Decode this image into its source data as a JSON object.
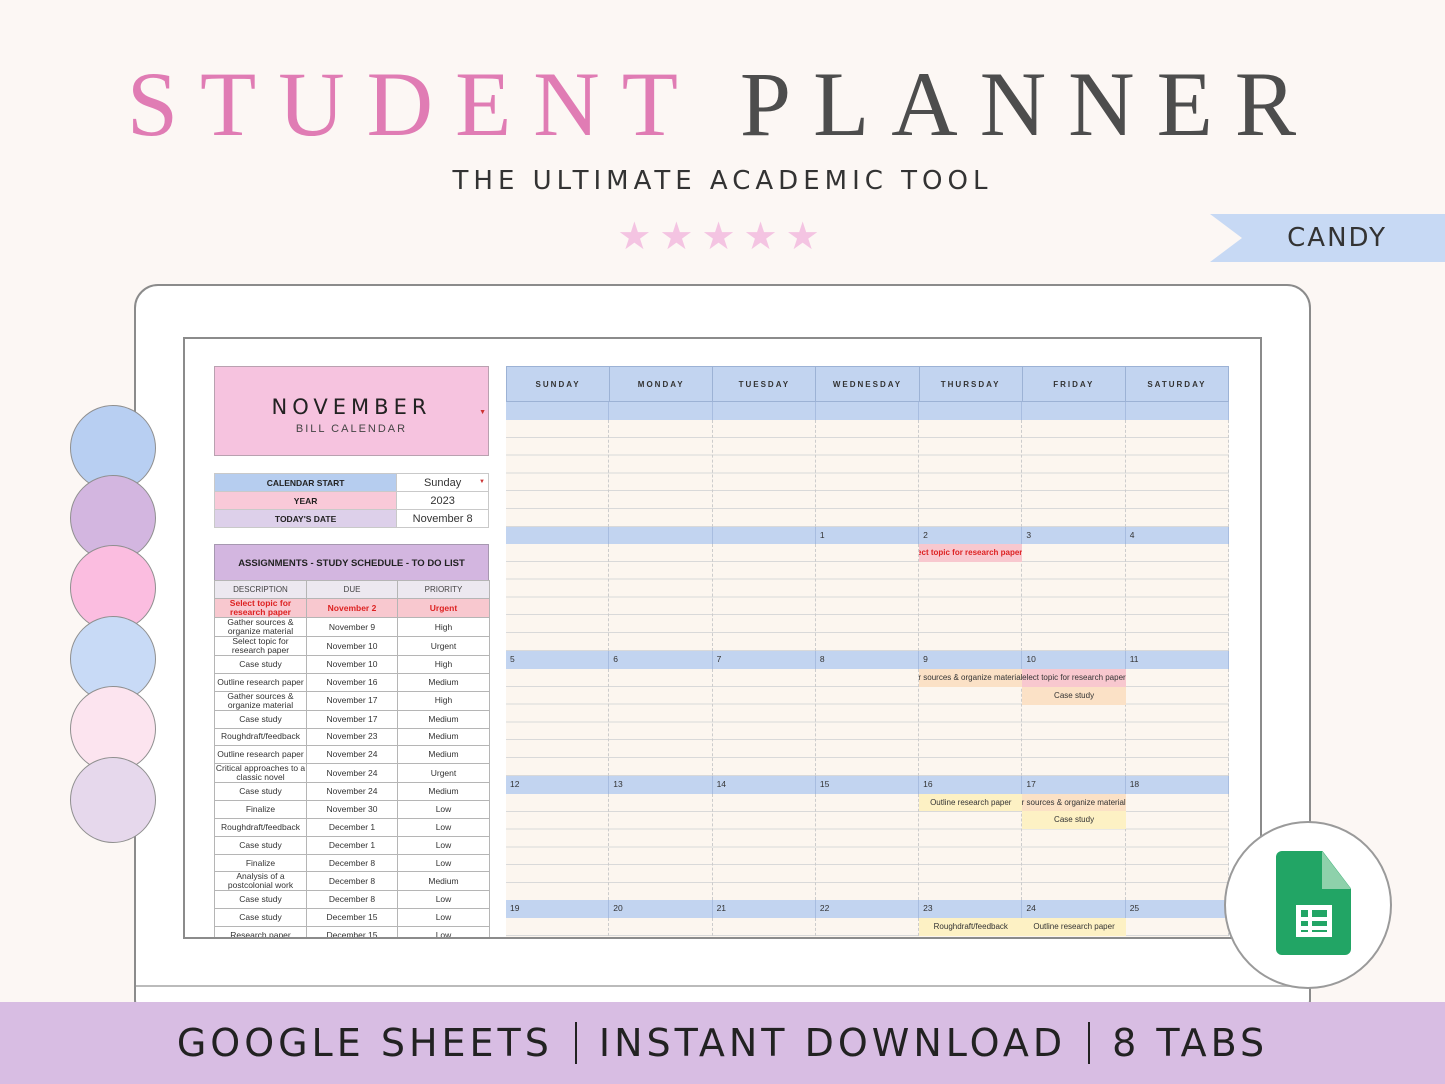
{
  "header": {
    "title_word1": "STUDENT",
    "title_word2": "PLANNER",
    "subtitle": "THE ULTIMATE ACADEMIC TOOL",
    "stars": "★★★★★",
    "rating": 5,
    "ribbon": "CANDY"
  },
  "swatch_colors": [
    "#b8cff2",
    "#d3b6e0",
    "#fbbde0",
    "#c8daf6",
    "#fce4ef",
    "#e6d8ec"
  ],
  "planner": {
    "month": "NOVEMBER",
    "month_sub": "BILL CALENDAR",
    "settings": [
      {
        "label": "CALENDAR START",
        "value": "Sunday",
        "color": "#b6cdef"
      },
      {
        "label": "YEAR",
        "value": "2023",
        "color": "#f9c9d8"
      },
      {
        "label": "TODAY'S DATE",
        "value": "November 8",
        "color": "#ddd0ea"
      }
    ],
    "assignments_title": "ASSIGNMENTS - STUDY SCHEDULE - TO DO LIST",
    "assignments_headers": [
      "DESCRIPTION",
      "DUE",
      "PRIORITY"
    ],
    "assignments": [
      {
        "desc": "Select topic for research paper",
        "due": "November 2",
        "priority": "Urgent",
        "urgent": true
      },
      {
        "desc": "Gather sources & organize material",
        "due": "November 9",
        "priority": "High"
      },
      {
        "desc": "Select topic for research paper",
        "due": "November 10",
        "priority": "Urgent"
      },
      {
        "desc": "Case study",
        "due": "November 10",
        "priority": "High"
      },
      {
        "desc": "Outline research paper",
        "due": "November 16",
        "priority": "Medium"
      },
      {
        "desc": "Gather sources & organize material",
        "due": "November 17",
        "priority": "High"
      },
      {
        "desc": "Case study",
        "due": "November 17",
        "priority": "Medium"
      },
      {
        "desc": "Roughdraft/feedback",
        "due": "November 23",
        "priority": "Medium"
      },
      {
        "desc": "Outline research paper",
        "due": "November 24",
        "priority": "Medium"
      },
      {
        "desc": "Critical approaches to a classic novel",
        "due": "November 24",
        "priority": "Urgent"
      },
      {
        "desc": "Case study",
        "due": "November 24",
        "priority": "Medium"
      },
      {
        "desc": "Finalize",
        "due": "November 30",
        "priority": "Low"
      },
      {
        "desc": "Roughdraft/feedback",
        "due": "December 1",
        "priority": "Low"
      },
      {
        "desc": "Case study",
        "due": "December 1",
        "priority": "Low"
      },
      {
        "desc": "Finalize",
        "due": "December 8",
        "priority": "Low"
      },
      {
        "desc": "Analysis of a postcolonial work",
        "due": "December 8",
        "priority": "Medium"
      },
      {
        "desc": "Case study",
        "due": "December 8",
        "priority": "Low"
      },
      {
        "desc": "Case study",
        "due": "December 15",
        "priority": "Low"
      },
      {
        "desc": "Research paper",
        "due": "December 15",
        "priority": "Low"
      }
    ],
    "days": [
      "SUNDAY",
      "MONDAY",
      "TUESDAY",
      "WEDNESDAY",
      "THURSDAY",
      "FRIDAY",
      "SATURDAY"
    ],
    "weeks": [
      {
        "dates": [
          "",
          "",
          "",
          "",
          "",
          "",
          ""
        ],
        "events": []
      },
      {
        "dates": [
          "",
          "",
          "",
          "1",
          "2",
          "3",
          "4"
        ],
        "events": [
          {
            "day": 4,
            "row": 0,
            "text": "Select topic for research paper",
            "style": "urgent",
            "align": "right"
          }
        ]
      },
      {
        "dates": [
          "5",
          "6",
          "7",
          "8",
          "9",
          "10",
          "11"
        ],
        "events": [
          {
            "day": 4,
            "row": 0,
            "text": "Gather sources & organize material",
            "style": "high",
            "align": "right"
          },
          {
            "day": 5,
            "row": 0,
            "text": "Select topic for research paper",
            "style": "urgent2",
            "align": "right"
          },
          {
            "day": 5,
            "row": 1,
            "text": "Case study",
            "style": "high",
            "align": "center"
          }
        ]
      },
      {
        "dates": [
          "12",
          "13",
          "14",
          "15",
          "16",
          "17",
          "18"
        ],
        "events": [
          {
            "day": 4,
            "row": 0,
            "text": "Outline research paper",
            "style": "med",
            "align": "center"
          },
          {
            "day": 5,
            "row": 0,
            "text": "Gather sources & organize material",
            "style": "high",
            "align": "right"
          },
          {
            "day": 5,
            "row": 1,
            "text": "Case study",
            "style": "med",
            "align": "center"
          }
        ]
      },
      {
        "dates": [
          "19",
          "20",
          "21",
          "22",
          "23",
          "24",
          "25"
        ],
        "events": [
          {
            "day": 4,
            "row": 0,
            "text": "Roughdraft/feedback",
            "style": "med",
            "align": "center"
          },
          {
            "day": 5,
            "row": 0,
            "text": "Outline research paper",
            "style": "med",
            "align": "center"
          }
        ]
      }
    ]
  },
  "footer": {
    "items": [
      "GOOGLE SHEETS",
      "INSTANT DOWNLOAD",
      "8 TABS"
    ]
  },
  "badge_icon": "google-sheets-icon"
}
